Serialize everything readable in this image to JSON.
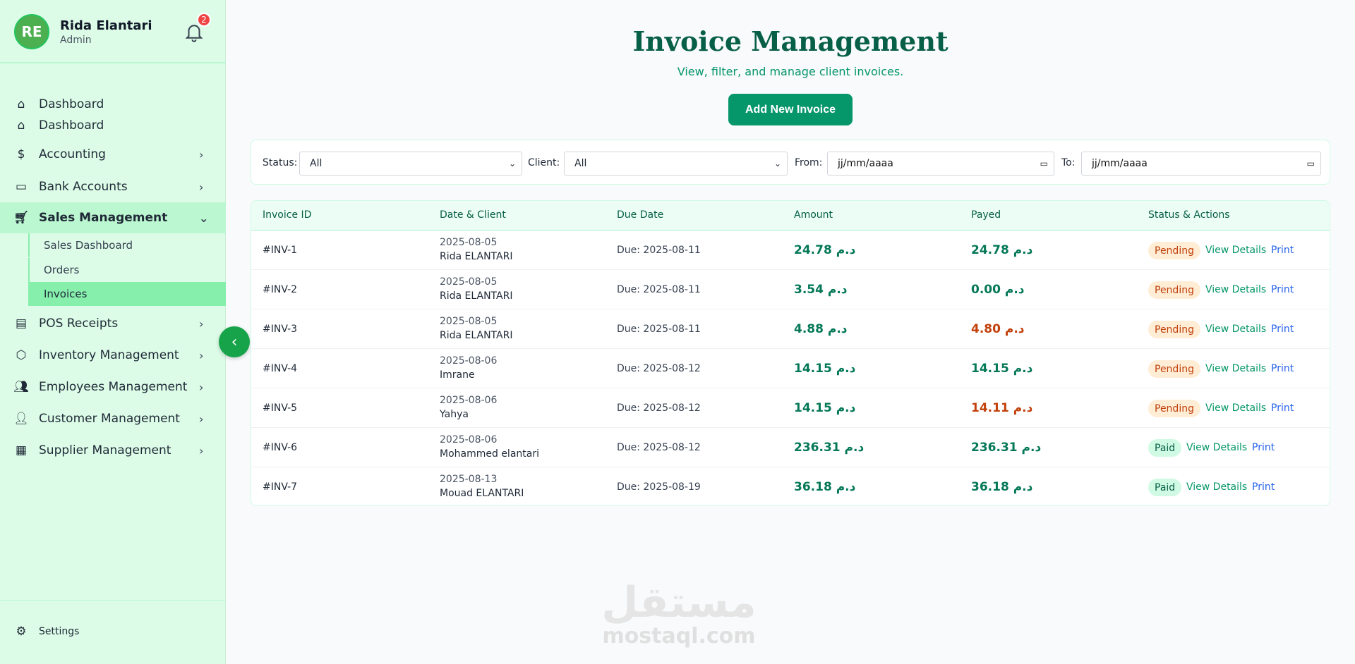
{
  "user": {
    "initials": "RE",
    "name": "Rida Elantari",
    "role": "Admin",
    "notifications": "2"
  },
  "sidebar": {
    "items": [
      {
        "label": "Dashboard",
        "icon": "home-icon"
      },
      {
        "label": "Dashboard",
        "icon": "home-icon"
      },
      {
        "label": "Accounting",
        "icon": "dollar-icon"
      },
      {
        "label": "Bank Accounts",
        "icon": "banknote-icon"
      },
      {
        "label": "Sales Management",
        "icon": "cart-icon"
      },
      {
        "label": "POS Receipts",
        "icon": "receipt-icon"
      },
      {
        "label": "Inventory Management",
        "icon": "box-icon"
      },
      {
        "label": "Employees Management",
        "icon": "users-icon"
      },
      {
        "label": "Customer Management",
        "icon": "user-icon"
      },
      {
        "label": "Supplier Management",
        "icon": "building-icon"
      }
    ],
    "sub": [
      "Sales Dashboard",
      "Orders",
      "Invoices"
    ],
    "settings": "Settings"
  },
  "header": {
    "title": "Invoice Management",
    "subtitle": "View, filter, and manage client invoices.",
    "add_label": "Add New Invoice"
  },
  "filters": {
    "status_label": "Status:",
    "status_value": "All",
    "client_label": "Client:",
    "client_value": "All",
    "from_label": "From:",
    "from_placeholder": "jj/mm/aaaa",
    "to_label": "To:",
    "to_placeholder": "jj/mm/aaaa"
  },
  "table": {
    "columns": [
      "Invoice ID",
      "Date & Client",
      "Due Date",
      "Amount",
      "Payed",
      "Status & Actions"
    ],
    "view_label": "View Details",
    "print_label": "Print",
    "rows": [
      {
        "id": "#INV-1",
        "date": "2025-08-05",
        "client": "Rida ELANTARI",
        "due": "Due: 2025-08-11",
        "amount": "24.78 د.م",
        "payed": "24.78 د.م",
        "payed_red": false,
        "status": "Pending"
      },
      {
        "id": "#INV-2",
        "date": "2025-08-05",
        "client": "Rida ELANTARI",
        "due": "Due: 2025-08-11",
        "amount": "3.54 د.م",
        "payed": "0.00 د.م",
        "payed_red": false,
        "status": "Pending"
      },
      {
        "id": "#INV-3",
        "date": "2025-08-05",
        "client": "Rida ELANTARI",
        "due": "Due: 2025-08-11",
        "amount": "4.88 د.م",
        "payed": "4.80 د.م",
        "payed_red": true,
        "status": "Pending"
      },
      {
        "id": "#INV-4",
        "date": "2025-08-06",
        "client": "Imrane",
        "due": "Due: 2025-08-12",
        "amount": "14.15 د.م",
        "payed": "14.15 د.م",
        "payed_red": false,
        "status": "Pending"
      },
      {
        "id": "#INV-5",
        "date": "2025-08-06",
        "client": "Yahya",
        "due": "Due: 2025-08-12",
        "amount": "14.15 د.م",
        "payed": "14.11 د.م",
        "payed_red": true,
        "status": "Pending"
      },
      {
        "id": "#INV-6",
        "date": "2025-08-06",
        "client": "Mohammed elantari",
        "due": "Due: 2025-08-12",
        "amount": "236.31 د.م",
        "payed": "236.31 د.م",
        "payed_red": false,
        "status": "Paid"
      },
      {
        "id": "#INV-7",
        "date": "2025-08-13",
        "client": "Mouad ELANTARI",
        "due": "Due: 2025-08-19",
        "amount": "36.18 د.م",
        "payed": "36.18 د.م",
        "payed_red": false,
        "status": "Paid"
      }
    ]
  },
  "watermark": {
    "arabic": "مستقل",
    "latin": "mostaql.com"
  }
}
